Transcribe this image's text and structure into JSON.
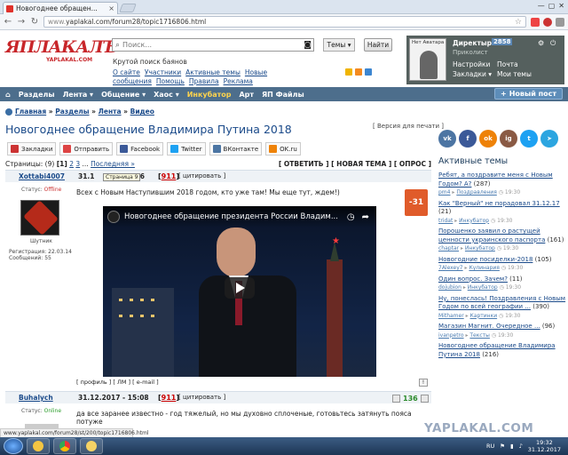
{
  "browser": {
    "tab_title": "Новогоднее обращен...",
    "url_prefix": "www.",
    "url": "yaplakal.com/forum28/topic1716806.html",
    "window_controls": [
      "—",
      "▢",
      "✕"
    ]
  },
  "header": {
    "logo_text": "ЯПЛАКАЛЪ",
    "logo_sub": "YAPLAKAL.COM",
    "search_placeholder": "Поиск...",
    "themes_label": "Темы",
    "find_label": "Найти",
    "search_hint": "Крутой поиск баянов",
    "links": [
      "О сайте",
      "Участники",
      "Активные темы",
      "Новые сообщения",
      "Помощь",
      "Правила",
      "Реклама"
    ]
  },
  "user": {
    "avatar_label": "Нет Аватара",
    "name": "Директыр",
    "rep": "2858",
    "rank": "Приколист",
    "settings": "Настройки",
    "mail": "Почта",
    "bookmarks": "Закладки",
    "my_topics": "Мои темы"
  },
  "menu": {
    "items": [
      "Разделы",
      "Лента",
      "Общение",
      "Хаос",
      "Инкубатор",
      "Арт",
      "ЯП Файлы"
    ],
    "new_post": "Новый пост"
  },
  "breadcrumb": [
    "Главная",
    "Разделы",
    "Лента",
    "Видео"
  ],
  "topic": {
    "title": "Новогоднее обращение Владимира Путина 2018",
    "print_version": "[ Версия для печати ]",
    "share": [
      "Закладки",
      "Отправить",
      "Facebook",
      "Twitter",
      "ВКонтакте",
      "OK.ru"
    ],
    "pages_label": "Страницы: (9)",
    "pages": [
      "1",
      "2",
      "3",
      "...",
      "Последняя »"
    ],
    "actions": "[ ОТВЕТИТЬ ] [ НОВАЯ ТЕМА ] [ ОПРОС ]",
    "tooltip": "Страница 9"
  },
  "post1": {
    "author": "Xottabi4007",
    "date": "31.1",
    "date_tail": "06",
    "num": "911",
    "cite": "[ цитировать ]",
    "status_label": "Статус:",
    "status": "Offline",
    "avatar_caption": "Шутник",
    "registered": "Регистрация: 22.03.14",
    "messages": "Сообщений: 55",
    "text": "Всех с Новым Наступившим 2018 годом, кто уже там! Мы еще тут, ждем!)",
    "rating": "-31",
    "video_title": "Новогоднее обращение президента России Владим...",
    "footer": "[ профиль ]  [ ЛМ ]  [ e-mail ]"
  },
  "post2": {
    "author": "Buhalych",
    "date": "31.12.2017 - 15:08",
    "num": "911",
    "cite": "[ цитировать ]",
    "status_label": "Статус:",
    "status": "Online",
    "rating": "136",
    "text": "да все заранее известно - год тяжелый, но мы духовно сплоченые, готовьтесь затянуть пояса потуже"
  },
  "sidebar": {
    "title": "Активные темы",
    "socials": [
      "vk",
      "fb",
      "ok",
      "ig",
      "tw",
      "tg"
    ],
    "topics": [
      {
        "title": "Ребят, а поздравите меня с Новым Годом? А?",
        "count": "(287)",
        "user": "pm4",
        "section": "Поздравления",
        "time": "19:30"
      },
      {
        "title": "Как \"Верный\" не порадовал 31.12.17",
        "count": "(21)",
        "user": "tridat",
        "section": "Инкубатор",
        "time": "19:30"
      },
      {
        "title": "Порошенко заявил о растущей ценности украинского паспорта",
        "count": "(161)",
        "user": "chaptar",
        "section": "Инкубатор",
        "time": "19:30"
      },
      {
        "title": "Новогодние посиделки-2018",
        "count": "(105)",
        "user": "7Alexey7",
        "section": "Кулинария",
        "time": "19:30"
      },
      {
        "title": "Один вопрос. Зачем?",
        "count": "(11)",
        "user": "dojubion",
        "section": "Инкубатор",
        "time": "19:30"
      },
      {
        "title": "Ну, понеслась! Поздравления с Новым Годом по всей географии ...",
        "count": "(390)",
        "user": "Mithamer",
        "section": "Картинки",
        "time": "19:30"
      },
      {
        "title": "Магазин Магнит. Очередное ...",
        "count": "(96)",
        "user": "ivanpetro",
        "section": "Тексты",
        "time": "19:30"
      },
      {
        "title": "Новогоднее обращение Владимира Путина 2018",
        "count": "(216)",
        "user": "",
        "section": "",
        "time": ""
      }
    ]
  },
  "statusbar": "www.yaplakal.com/forum28/st/200/topic1716806.html",
  "watermark": "YAPLAKAL.COM",
  "taskbar": {
    "lang": "RU",
    "time": "19:32",
    "date": "31.12.2017"
  }
}
